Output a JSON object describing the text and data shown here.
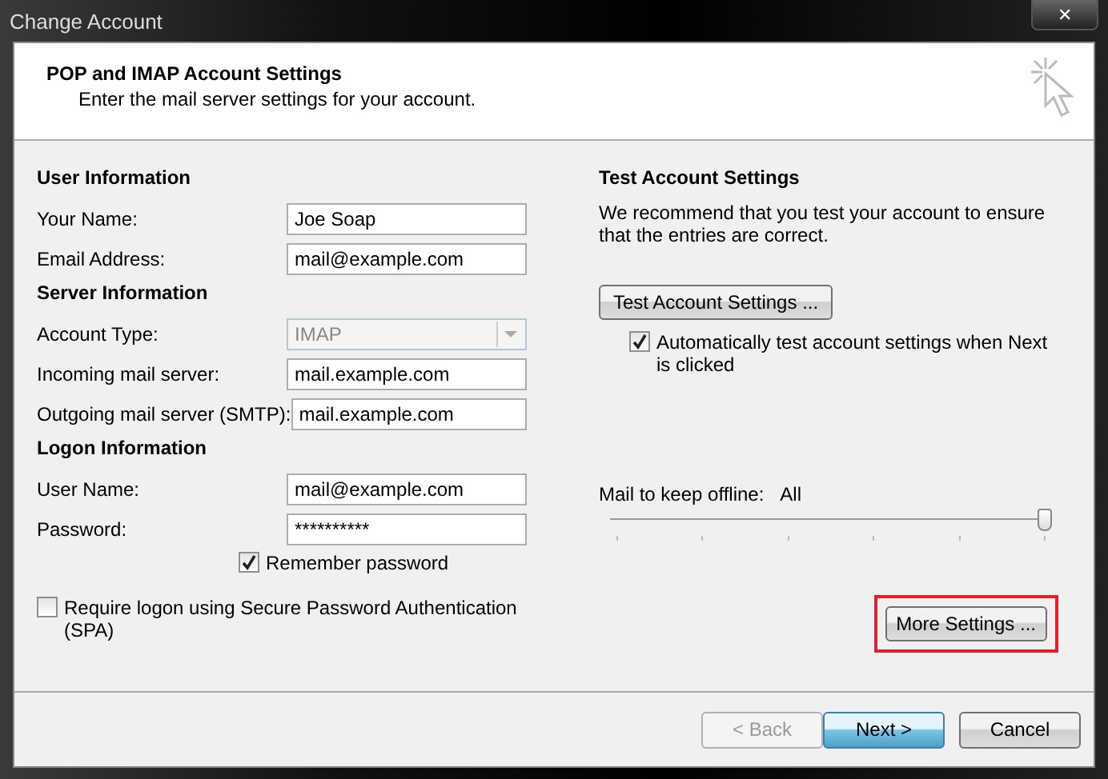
{
  "window": {
    "title": "Change Account",
    "close": "✕"
  },
  "header": {
    "title": "POP and IMAP Account Settings",
    "subtitle": "Enter the mail server settings for your account."
  },
  "sections": [
    {
      "heading": "User Information",
      "fields": [
        {
          "kind": "text",
          "label": "Your Name:",
          "value": "Joe Soap"
        },
        {
          "kind": "text",
          "label": "Email Address:",
          "value": "mail@example.com"
        }
      ]
    },
    {
      "heading": "Server Information",
      "fields": [
        {
          "kind": "dropdown",
          "label": "Account Type:",
          "value": "IMAP",
          "disabled": true
        },
        {
          "kind": "text",
          "label": "Incoming mail server:",
          "value": "mail.example.com"
        },
        {
          "kind": "text",
          "label": "Outgoing mail server (SMTP):",
          "value": "mail.example.com"
        }
      ]
    },
    {
      "heading": "Logon Information",
      "fields": [
        {
          "kind": "text",
          "label": "User Name:",
          "value": "mail@example.com"
        },
        {
          "kind": "text",
          "label": "Password:",
          "value": "**********"
        }
      ]
    }
  ],
  "remember_password": {
    "label": "Remember password",
    "checked": true
  },
  "spa": {
    "label": "Require logon using Secure Password Authentication (SPA)",
    "checked": false
  },
  "test": {
    "heading": "Test Account Settings",
    "description": "We recommend that you test your account to ensure that the entries are correct.",
    "button": "Test Account Settings ...",
    "auto_test": {
      "label": "Automatically test account settings when Next is clicked",
      "checked": true
    }
  },
  "offline": {
    "label": "Mail to keep offline:",
    "reading": "All",
    "level": 1
  },
  "more_settings": {
    "label": "More Settings ...",
    "highlighted": true
  },
  "buttons": [
    {
      "label": "< Back",
      "disabled": true,
      "default": false
    },
    {
      "label": "Next >",
      "disabled": false,
      "default": true
    },
    {
      "label": "Cancel",
      "disabled": false,
      "default": false
    }
  ]
}
